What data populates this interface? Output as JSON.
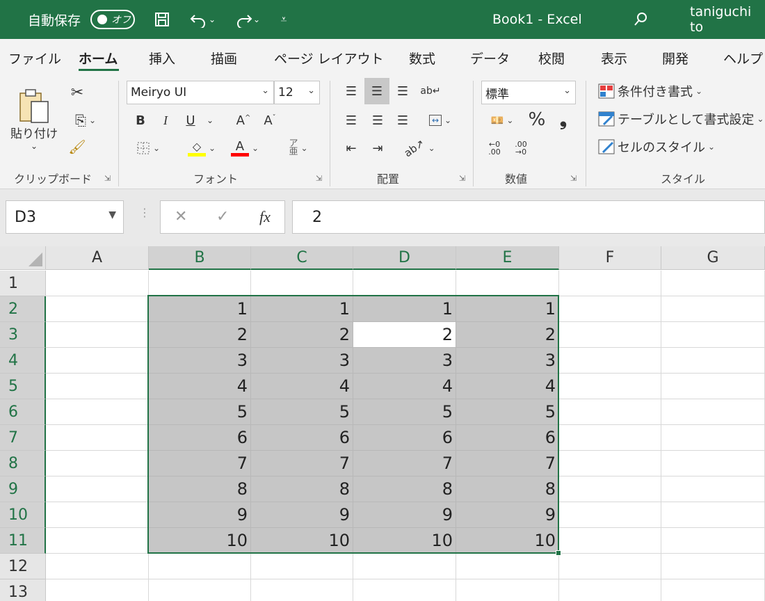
{
  "titlebar": {
    "autosave_label": "自動保存",
    "autosave_state": "オフ",
    "doc_title": "Book1  -  Excel",
    "user": "taniguchi to"
  },
  "tabs": [
    {
      "label": "ファイル",
      "active": false
    },
    {
      "label": "ホーム",
      "active": true
    },
    {
      "label": "挿入",
      "active": false
    },
    {
      "label": "描画",
      "active": false
    },
    {
      "label": "ページ レイアウト",
      "active": false
    },
    {
      "label": "数式",
      "active": false
    },
    {
      "label": "データ",
      "active": false
    },
    {
      "label": "校閲",
      "active": false
    },
    {
      "label": "表示",
      "active": false
    },
    {
      "label": "開発",
      "active": false
    },
    {
      "label": "ヘルプ",
      "active": false
    }
  ],
  "ribbon": {
    "clipboard": {
      "paste_label": "貼り付け",
      "group_label": "クリップボード"
    },
    "font": {
      "font_name": "Meiryo UI",
      "font_size": "12",
      "group_label": "フォント",
      "bold": "B",
      "italic": "I",
      "underline": "U"
    },
    "alignment": {
      "group_label": "配置"
    },
    "number": {
      "format": "標準",
      "group_label": "数値",
      "percent": "%"
    },
    "styles": {
      "conditional": "条件付き書式",
      "table": "テーブルとして書式設定",
      "cell_styles": "セルのスタイル",
      "group_label": "スタイル"
    }
  },
  "formula_bar": {
    "name_box": "D3",
    "fx": "fx",
    "value": "2"
  },
  "sheet": {
    "columns": [
      "A",
      "B",
      "C",
      "D",
      "E",
      "F",
      "G"
    ],
    "rows": [
      "1",
      "2",
      "3",
      "4",
      "5",
      "6",
      "7",
      "8",
      "9",
      "10",
      "11",
      "12",
      "13"
    ],
    "data_B": [
      "",
      "1",
      "2",
      "3",
      "4",
      "5",
      "6",
      "7",
      "8",
      "9",
      "10",
      "",
      ""
    ],
    "data_C": [
      "",
      "1",
      "2",
      "3",
      "4",
      "5",
      "6",
      "7",
      "8",
      "9",
      "10",
      "",
      ""
    ],
    "data_D": [
      "",
      "1",
      "2",
      "3",
      "4",
      "5",
      "6",
      "7",
      "8",
      "9",
      "10",
      "",
      ""
    ],
    "data_E": [
      "",
      "1",
      "2",
      "3",
      "4",
      "5",
      "6",
      "7",
      "8",
      "9",
      "10",
      "",
      ""
    ],
    "selection": "B2:E11",
    "active_cell": "D3",
    "accent_color": "#217346"
  }
}
